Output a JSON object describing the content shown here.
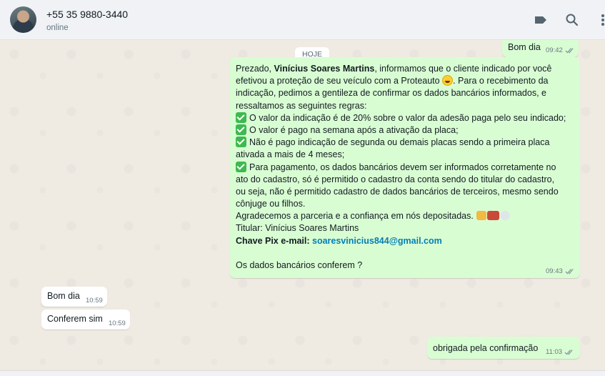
{
  "header": {
    "contact_name": "+55 35 9880-3440",
    "status": "online",
    "icons": [
      "label-icon",
      "search-icon",
      "menu-icon"
    ]
  },
  "date_chip": "HOJE",
  "messages": [
    {
      "direction": "out",
      "text": "Bom dia",
      "time": "09:42"
    },
    {
      "direction": "out",
      "lines": [
        {
          "parts": [
            "Prezado, ",
            "Vinícius Soares Martins",
            ", informamos que o cliente indicado por você"
          ]
        },
        {
          "text": "efetivou a proteção de seu veículo com a Proteauto",
          "tail": ". Para o recebimento da"
        },
        {
          "text": "indicação, pedimos a gentileza de confirmar os dados bancários informados, e"
        },
        {
          "text": "ressaltamos as seguintes regras:"
        },
        {
          "text": "O valor da indicação é de 20% sobre o valor da adesão paga pelo seu indicado;"
        },
        {
          "text": "O valor é pago na semana após a ativação da placa;"
        },
        {
          "text": "Não é pago indicação de segunda ou demais placas sendo a primeira placa"
        },
        {
          "text": "ativada a mais de 4 meses;"
        },
        {
          "text": "Para pagamento, os dados bancários devem ser informados corretamente no"
        },
        {
          "text": "ato do cadastro, só é permitido o cadastro da conta sendo do titular do cadastro,"
        },
        {
          "text": "ou seja, não é permitido cadastro de dados bancários de terceiros, mesmo sendo"
        },
        {
          "text": "cônjuge ou filhos."
        },
        {
          "text": "Agradecemos a parceria e a confiança em nós depositadas."
        },
        {
          "text": "Titular: Vinícius Soares Martins"
        },
        {
          "label": "Chave Pix e-mail:",
          "email": "soaresvinicius844@gmail.com"
        },
        {
          "text": ""
        },
        {
          "text": "Os dados bancários conferem ?"
        }
      ],
      "time": "09:43"
    },
    {
      "direction": "in",
      "text": "Bom dia",
      "time": "10:59"
    },
    {
      "direction": "in",
      "text": "Conferem sim",
      "time": "10:59"
    },
    {
      "direction": "out",
      "text": "obrigada pela confirmação",
      "time": "11:03"
    }
  ],
  "colors": {
    "outgoing_bubble": "#d9fdd3",
    "incoming_bubble": "#ffffff",
    "chat_background": "#efeae2",
    "link": "#027eb5",
    "read_ticks": "#8696a0"
  }
}
